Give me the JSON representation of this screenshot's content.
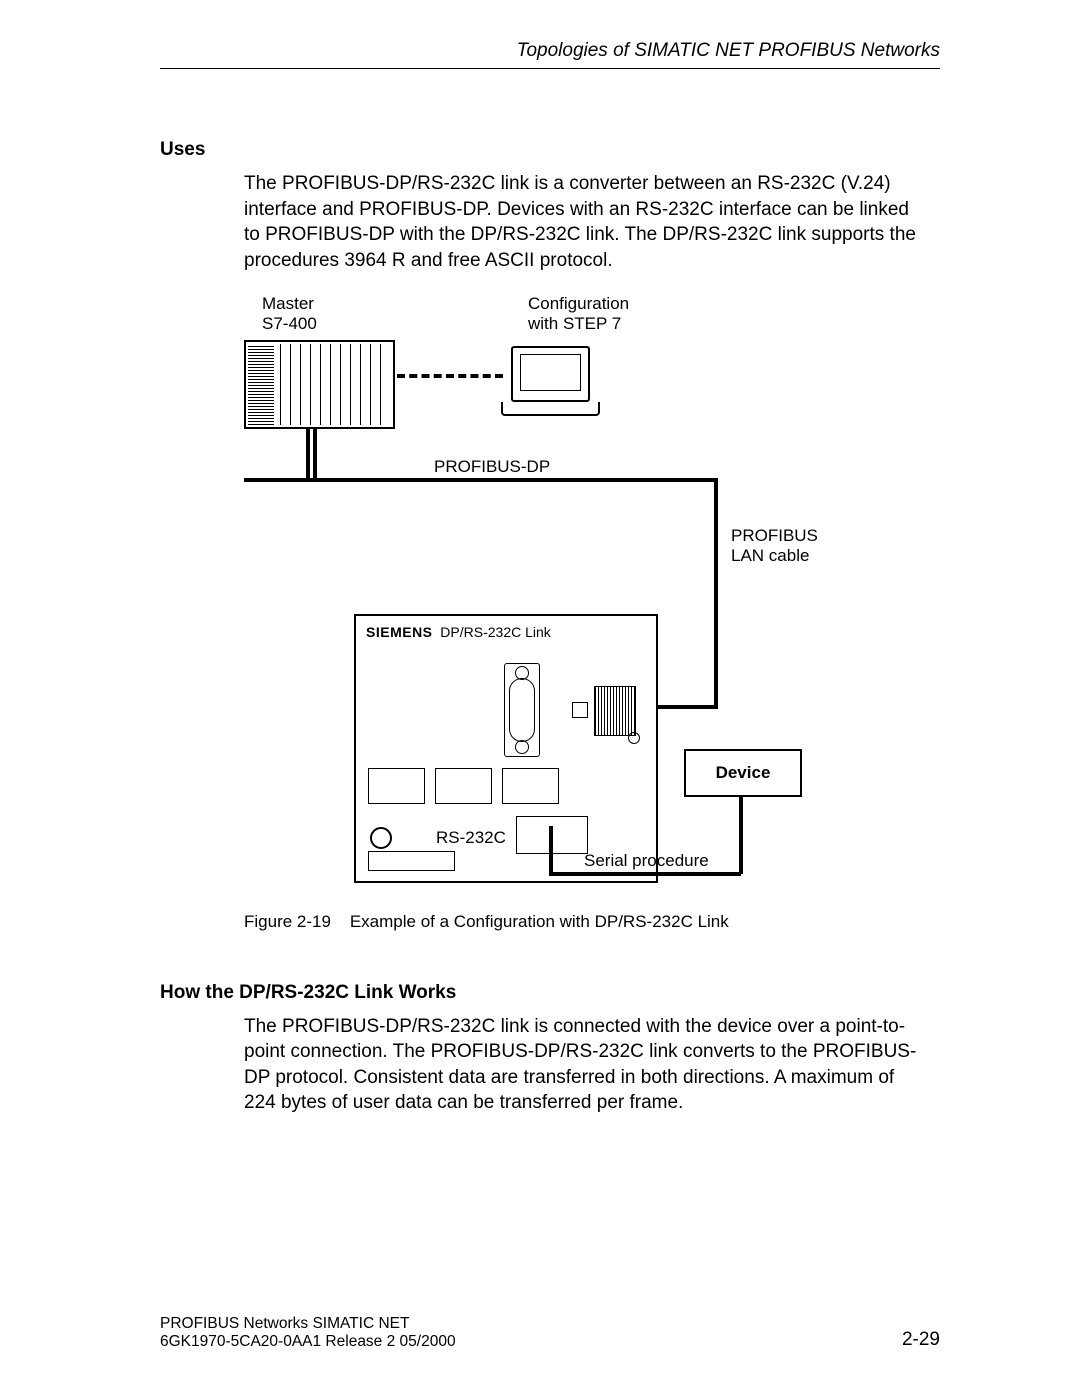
{
  "header": {
    "topic": "Topologies of SIMATIC NET PROFIBUS Networks"
  },
  "section1": {
    "title": "Uses",
    "body": "The PROFIBUS-DP/RS-232C link is a converter between an RS-232C (V.24) interface and PROFIBUS-DP. Devices with an RS-232C interface can be linked to PROFIBUS-DP with the DP/RS-232C link. The DP/RS-232C link supports the procedures 3964 R and free ASCII protocol."
  },
  "figure": {
    "labels": {
      "master_l1": "Master",
      "master_l2": "S7-400",
      "config_l1": "Configuration",
      "config_l2": "with STEP 7",
      "bus": "PROFIBUS-DP",
      "lan_l1": "PROFIBUS",
      "lan_l2": "LAN cable",
      "link_brand": "SIEMENS",
      "link_model": "DP/RS-232C Link",
      "rs232": "RS-232C",
      "serial": "Serial procedure",
      "device": "Device"
    },
    "caption_no": "Figure 2-19",
    "caption": "Example of a Configuration with DP/RS-232C Link"
  },
  "section2": {
    "title": "How the DP/RS-232C Link Works",
    "body": "The PROFIBUS-DP/RS-232C link is connected with the device over a point-to-point connection. The PROFIBUS-DP/RS-232C link converts to the PROFIBUS-DP protocol. Consistent data are transferred in both directions. A maximum of 224 bytes of user data can be transferred per frame."
  },
  "footer": {
    "l1": "PROFIBUS Networks SIMATIC NET",
    "l2": "6GK1970-5CA20-0AA1 Release 2 05/2000",
    "page": "2-29"
  }
}
